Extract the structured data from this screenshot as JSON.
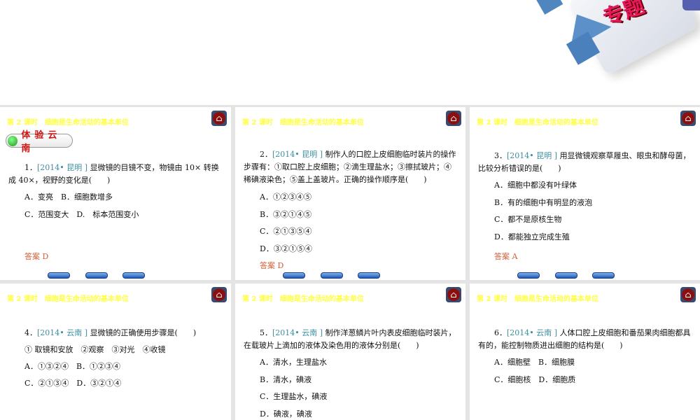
{
  "decoration": {
    "title_fragment": "专题"
  },
  "header_title": "第 2 课时　细胞是生命活动的基本单位",
  "section_badge": "体验云南",
  "colors": {
    "header": "#ffff44",
    "source": "#3a8fa0",
    "answer": "#d2603a",
    "badge": "#d01515"
  },
  "slides": [
    {
      "num": "1．",
      "source": "[2014• 昆明 ]",
      "lines": [
        "显微镜的目镜不变，物镜由 10× 转换",
        "成 40×，视野的变化是(　　)"
      ],
      "options": [
        "A．变亮　B．细胞数增多",
        "C．范围变大　D.　标本范围变小"
      ],
      "answer": "答案 D"
    },
    {
      "num": "2．",
      "source": "[2014• 昆明 ]",
      "lines": [
        "制作人的口腔上皮细胞临时装片的操作",
        "步骤有：①取口腔上皮细胞；②滴生理盐水；③擦拭玻片；④",
        "稀碘液染色；⑤盖上盖玻片。正确的操作顺序是(　　)"
      ],
      "options": [
        "A．①②③④⑤",
        "B．③②①④⑤",
        "C．②①③⑤④",
        "D．③②①⑤④"
      ],
      "answer": "答案 D"
    },
    {
      "num": "3．",
      "source": "[2014• 昆明 ]",
      "lines": [
        "用显微镜观察草履虫、眼虫和酵母菌，",
        "比较分析错误的是(　　)"
      ],
      "options": [
        "A．细胞中都没有叶绿体",
        "B．有的细胞中有明显的液泡",
        "C．都不是原核生物",
        "D．都能独立完成生殖"
      ],
      "answer": "答案 A"
    },
    {
      "num": "4．",
      "source": "[2014• 云南 ]",
      "lines": [
        "显微镜的正确使用步骤是(　　)"
      ],
      "options": [
        "① 取镜和安放　②观察　③对光　④收镜",
        "A．①③②④　B．①②③④",
        "C．②①③④　D．③②①④"
      ]
    },
    {
      "num": "5．",
      "source": "[2014• 云南 ]",
      "lines": [
        "制作洋葱鳞片叶内表皮细胞临时装片，",
        "在载玻片上滴加的液体及染色用的液体分别是(　　)"
      ],
      "options": [
        "A．清水，生理盐水",
        "B．清水，碘液",
        "C．生理盐水，碘液",
        "D．碘液，碘液"
      ]
    },
    {
      "num": "6．",
      "source": "[2014• 云南 ]",
      "lines": [
        "人体口腔上皮细胞和番茄果肉细胞都具",
        "有的，能控制物质进出细胞的结构是(　　)"
      ],
      "options": [
        "A．细胞壁　B．细胞膜",
        "C．细胞核　D．细胞质"
      ]
    }
  ]
}
